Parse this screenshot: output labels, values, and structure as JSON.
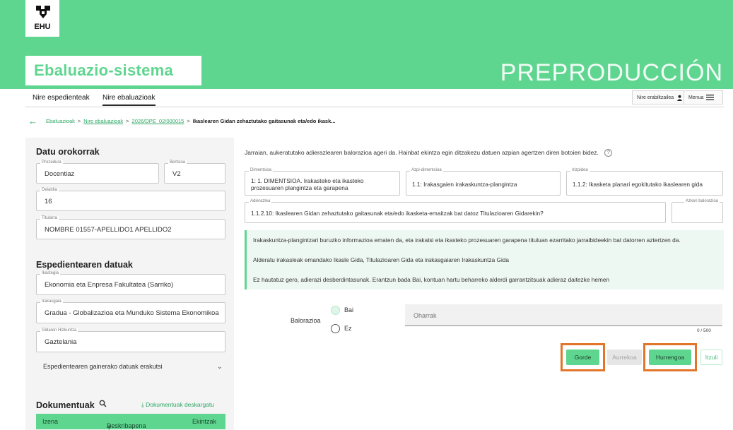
{
  "header": {
    "logo_text": "EHU",
    "app_title": "Ebaluazio-sistema",
    "environment_label": "PREPRODUCCIÓN"
  },
  "nav": {
    "tabs": [
      {
        "label": "Nire espedienteak",
        "active": false
      },
      {
        "label": "Nire ebaluazioak",
        "active": true
      }
    ],
    "user_label": "Nire erabiltzailea",
    "menu_label": "Menua"
  },
  "breadcrumb": {
    "items": [
      "Ebaluazioak",
      "Nire ebaluazioak",
      "2026/DPE_02/000015"
    ],
    "current": "Ikaslearen Gidan zehaztutako gaitasunak eta/edo ikask..."
  },
  "general": {
    "title": "Datu orokorrak",
    "fields": [
      {
        "label": "Prozedura",
        "value": "Docentiaz"
      },
      {
        "label": "Bertsioa",
        "value": "V2"
      },
      {
        "label": "Deialdia",
        "value": "16"
      },
      {
        "label": "Titularra",
        "value": "NOMBRE 01557-APELLIDO1 APELLIDO2"
      }
    ]
  },
  "record": {
    "title": "Espedientearen datuak",
    "fields": [
      {
        "label": "Ikastegia",
        "value": "Ekonomia eta Enpresa Fakultatea (Sarriko)"
      },
      {
        "label": "Irakasgaia",
        "value": "Gradua - Globalizazioa eta Munduko Sistema Ekonomikoa"
      },
      {
        "label": "Gidaren Hizkuntza",
        "value": "Gaztelania"
      }
    ],
    "expand_label": "Espedientearen gainerako datuak erakutsi"
  },
  "documents": {
    "title": "Dokumentuak",
    "download_label": "Dokumentuak deskargatu",
    "columns": [
      "Izena",
      "Deskribapena",
      "Ekintzak"
    ]
  },
  "main": {
    "intro": "Jarraian, aukeratutako adierazlearen balorazioa ageri da. Hainbat ekintza egin ditzakezu datuen azpian agertzen diren botoien bidez.",
    "dimension": {
      "label": "Dimentsioa",
      "value": "1: 1. DIMENTSIOA. Irakasteko eta ikasteko prozesuaren plangintza eta garapena"
    },
    "subdimension": {
      "label": "Azpi-dimentsioa",
      "value": "1.1: Irakasgaien irakaskuntza-plangintza"
    },
    "guideline": {
      "label": "Irizpidea",
      "value": "1.1.2: Ikasketa planari egokitutako ikaslearen gida"
    },
    "indicator": {
      "label": "Adierazlea",
      "value": "1.1.2.10: Ikaslearen Gidan zehaztutako gaitasunak eta/edo ikasketa-emaitzak bat datoz Titulazioaren Gidarekin?"
    },
    "last_rating": {
      "label": "Azken balorazioa",
      "value": ""
    },
    "info_lines": [
      "Irakaskuntza-plangintzari buruzko informazioa ematen da, eta irakatsi eta ikasteko prozesuaren garapena tituluan ezarritako jarraibideekin bat datorren aztertzen da.",
      "Alderatu irakasleak emandako Ikasle Gida, Titulazioaren Gida eta irakasgaiaren Irakaskuntza Gida",
      "Ez hautatuz gero, adierazi desberdintasunak. Erantzun bada Bai, kontuan hartu beharreko alderdi garrantzitsuak adieraz daitezke hemen"
    ],
    "rating_label": "Balorazioa",
    "options": [
      "Bai",
      "Ez"
    ],
    "notes_placeholder": "Oharrak",
    "char_counter": "0 / 500",
    "buttons": {
      "save": "Gorde",
      "previous": "Aurrekoa",
      "next": "Hurrengoa",
      "back": "Itzuli"
    }
  },
  "colors": {
    "brand_green": "#5fd68f",
    "highlight": "#e4742a"
  }
}
